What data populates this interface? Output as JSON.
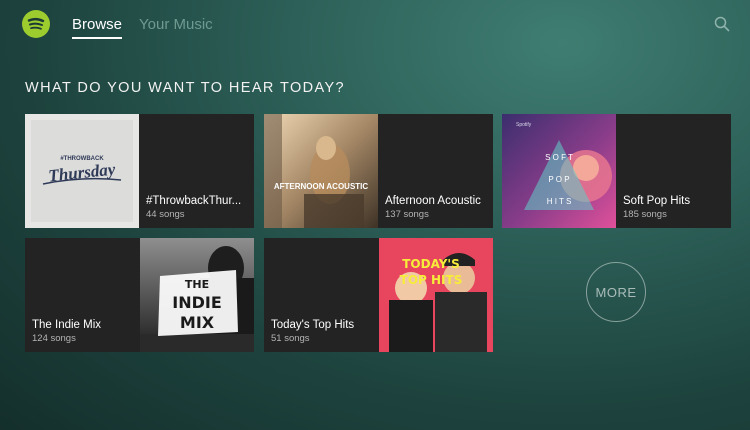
{
  "nav": {
    "tabs": [
      {
        "label": "Browse",
        "active": true
      },
      {
        "label": "Your Music",
        "active": false
      }
    ],
    "icons": {
      "logo": "spotify-logo-icon",
      "search": "search-icon"
    }
  },
  "heading": "WHAT DO YOU WANT TO HEAR TODAY?",
  "playlists": [
    {
      "title": "#ThrowbackThur...",
      "count": "44 songs",
      "art_text": [
        "#THROWBACK",
        "Thursday"
      ]
    },
    {
      "title": "Afternoon Acoustic",
      "count": "137 songs",
      "art_text": "AFTERNOON ACOUSTIC"
    },
    {
      "title": "Soft Pop Hits",
      "count": "185 songs",
      "art_text": [
        "Spotify",
        "S O F T",
        "P O P",
        "H I T S"
      ]
    },
    {
      "title": "The Indie Mix",
      "count": "124 songs",
      "art_text": [
        "THE",
        "INDIE",
        "MIX"
      ]
    },
    {
      "title": "Today's Top Hits",
      "count": "51 songs",
      "art_text": [
        "TODAY'S",
        "TOP HITS"
      ]
    }
  ],
  "more_label": "MORE",
  "colors": {
    "accent": "#9ccc2d",
    "card": "#232323",
    "inactive_tab": "#6f9a92"
  }
}
